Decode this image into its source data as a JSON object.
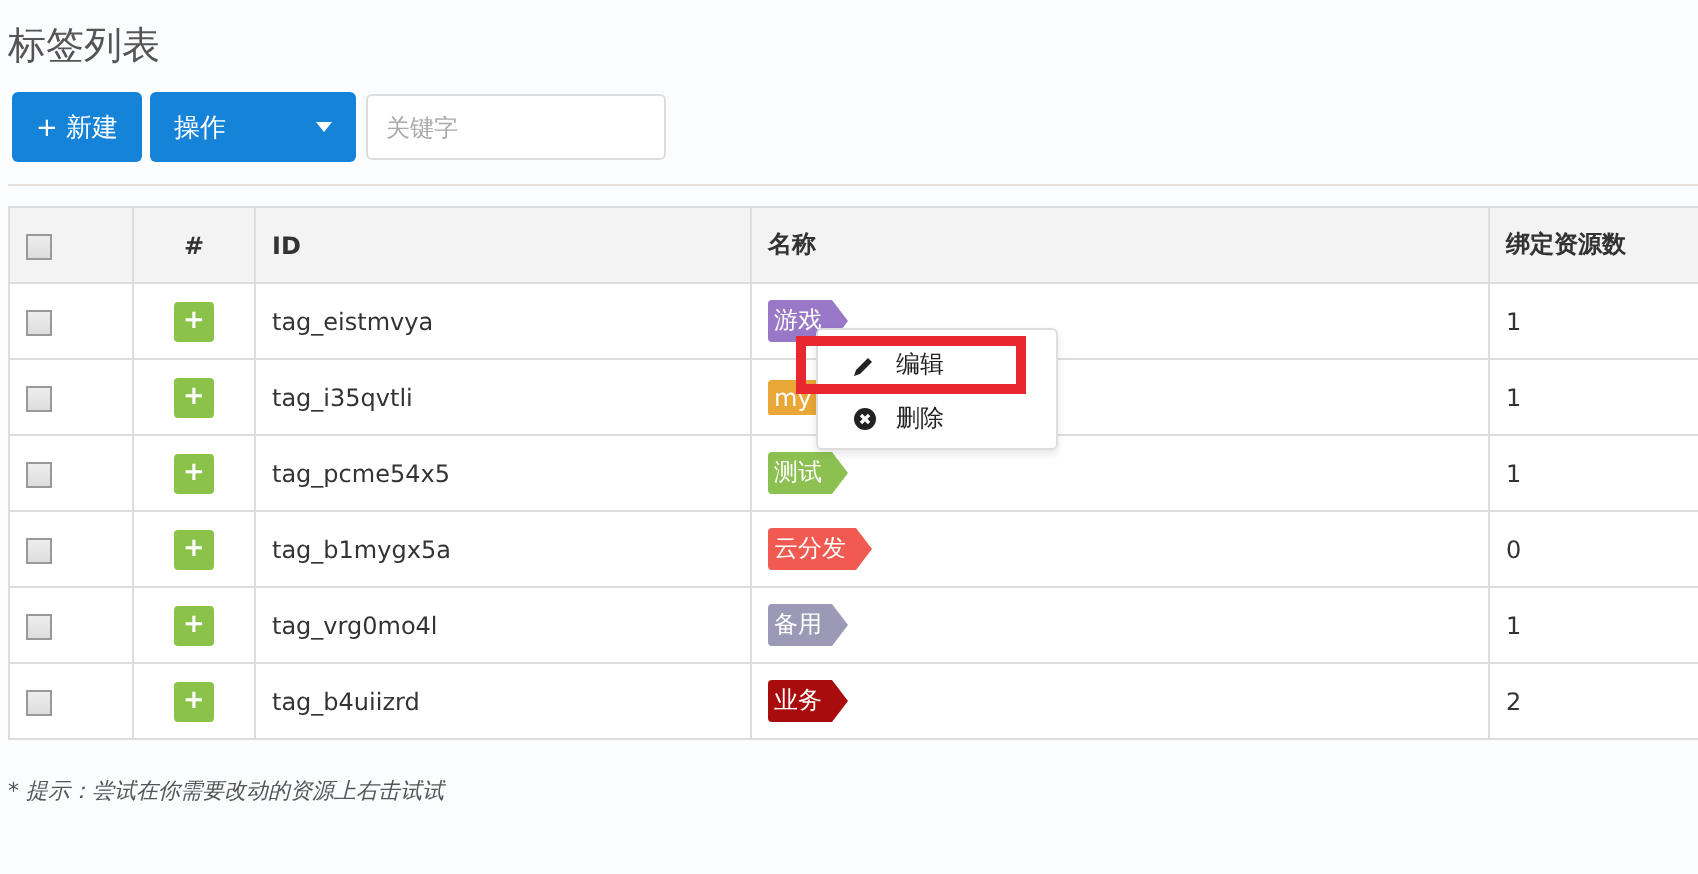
{
  "title": "标签列表",
  "toolbar": {
    "new_button": "+ 新建",
    "action_button": "操作",
    "search": {
      "placeholder": "关键字"
    }
  },
  "table": {
    "header_checked": false,
    "columns": [
      "#",
      "ID",
      "名称",
      "绑定资源数"
    ],
    "rows": [
      {
        "checked": false,
        "expand": "+",
        "id": "tag_eistmvya",
        "tag": {
          "name": "游戏",
          "color": "#9a78c8"
        },
        "count": "1"
      },
      {
        "checked": false,
        "expand": "+",
        "id": "tag_i35qvtli",
        "tag": {
          "name": "my",
          "color": "#e8a736"
        },
        "count": "1"
      },
      {
        "checked": false,
        "expand": "+",
        "id": "tag_pcme54x5",
        "tag": {
          "name": "测试",
          "color": "#8cc152"
        },
        "count": "1"
      },
      {
        "checked": false,
        "expand": "+",
        "id": "tag_b1mygx5a",
        "tag": {
          "name": "云分发",
          "color": "#f05a50"
        },
        "count": "0"
      },
      {
        "checked": false,
        "expand": "+",
        "id": "tag_vrg0mo4l",
        "tag": {
          "name": "备用",
          "color": "#9b99b5"
        },
        "count": "1"
      },
      {
        "checked": false,
        "expand": "+",
        "id": "tag_b4uiizrd",
        "tag": {
          "name": "业务",
          "color": "#a80c0c"
        },
        "count": "2"
      }
    ]
  },
  "context_menu": {
    "items": [
      {
        "kind": "edit",
        "label": "编辑",
        "highlighted": true
      },
      {
        "kind": "delete",
        "label": "删除",
        "highlighted": false
      }
    ]
  },
  "hint": "* 提示：尝试在你需要改动的资源上右击试试"
}
